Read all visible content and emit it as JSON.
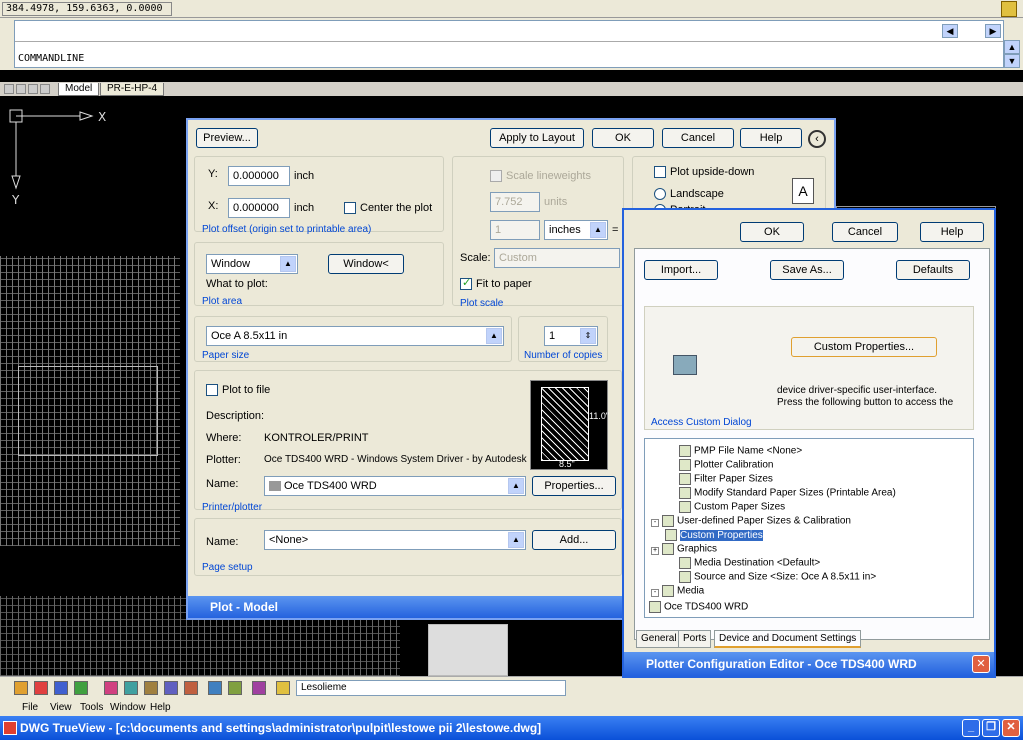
{
  "status": {
    "coords": "384.4978, 159.6363, 0.0000"
  },
  "command": {
    "prompt": "COMMANDLINE"
  },
  "tabs": [
    "Model",
    "PR-E-HP-4"
  ],
  "plot_dialog": {
    "title": "Plot - Model",
    "page_setup_group": "Page setup",
    "page_setup_name_label": "Name:",
    "page_setup_name_value": "<None>",
    "add_button": "Add...",
    "printer_group": "Printer/plotter",
    "printer_name_label": "Name:",
    "printer_name_value": "Oce TDS400 WRD",
    "properties_button": "Properties...",
    "plotter_label": "Plotter:",
    "plotter_value": "Oce TDS400 WRD - Windows System Driver - by Autodesk",
    "where_label": "Where:",
    "where_value": "KONTROLER/PRINT",
    "description_label": "Description:",
    "plot_to_file": "Plot to file",
    "paper_size_group": "Paper size",
    "paper_size_value": "Oce A 8.5x11 in",
    "copies_group": "Number of copies",
    "copies_value": "1",
    "plot_area_group": "Plot area",
    "what_to_plot_label": "What to plot:",
    "what_to_plot_value": "Window",
    "window_button": "Window<",
    "plot_scale_group": "Plot scale",
    "fit_to_paper": "Fit to paper",
    "scale_label": "Scale:",
    "scale_value": "Custom",
    "units_value": "inches",
    "scale_num": "1",
    "scale_den": "7.752",
    "units_label": "units",
    "scale_lineweights": "Scale lineweights",
    "plot_offset_group": "Plot offset (origin set to printable area)",
    "x_label": "X:",
    "x_value": "0.000000",
    "x_unit": "inch",
    "center_plot": "Center the plot",
    "y_label": "Y:",
    "y_value": "0.000000",
    "y_unit": "inch",
    "plot_upside_down": "Plot upside-down",
    "landscape": "Landscape",
    "portrait": "Portrait",
    "preview_button": "Preview...",
    "apply_button": "Apply to Layout",
    "ok_button": "OK",
    "cancel_button": "Cancel",
    "help_button": "Help",
    "preview_width": "8.5\"",
    "preview_height": "11.0\""
  },
  "pce": {
    "title": "Plotter Configuration Editor - Oce TDS400 WRD",
    "tabs": [
      "General",
      "Ports",
      "Device and Document Settings"
    ],
    "tree": [
      "Oce TDS400 WRD",
      "Media",
      "Source and Size <Size: Oce A 8.5x11 in>",
      "Media Destination <Default>",
      "Graphics",
      "Custom Properties",
      "User-defined Paper Sizes & Calibration",
      "Custom Paper Sizes",
      "Modify Standard Paper Sizes (Printable Area)",
      "Filter Paper Sizes",
      "Plotter Calibration",
      "PMP File Name <None>"
    ],
    "custom_group": "Access Custom Dialog",
    "custom_text_1": "Press the following button to access the",
    "custom_text_2": "device driver-specific user-interface.",
    "custom_button": "Custom Properties...",
    "import_button": "Import...",
    "saveas_button": "Save As...",
    "defaults_button": "Defaults",
    "ok_button": "OK",
    "cancel_button": "Cancel",
    "help_button": "Help"
  },
  "toolbar": {
    "layer": "Lesolieme"
  },
  "menu": [
    "File",
    "View",
    "Tools",
    "Window",
    "Help"
  ],
  "window": {
    "title": "DWG TrueView - [c:\\documents and settings\\administrator\\pulpit\\lestowe pii 2\\lestowe.dwg]"
  }
}
